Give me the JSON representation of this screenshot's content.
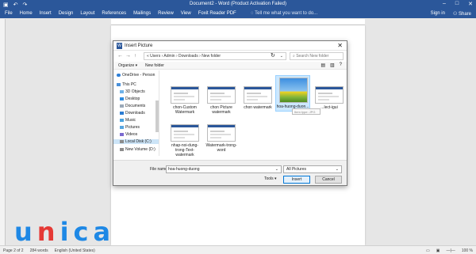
{
  "titlebar": {
    "title": "Document2 - Word (Product Activation Failed)",
    "save_icon": "save-icon",
    "undo_icon": "undo-icon",
    "redo_icon": "redo-icon"
  },
  "ribbon": {
    "tabs": [
      "File",
      "Home",
      "Insert",
      "Design",
      "Layout",
      "References",
      "Mailings",
      "Review",
      "View",
      "Foxit Reader PDF"
    ],
    "tell_me": "Tell me what you want to do...",
    "sign_in": "Sign in",
    "share": "Share",
    "accent": "#2b579a"
  },
  "dialog": {
    "title": "Insert Picture",
    "close": "✕",
    "address": [
      "This PC",
      "Users",
      "Admin",
      "Downloads",
      "New folder"
    ],
    "address_text": "« Users › Admin › Downloads › New folder",
    "search_placeholder": "Search New folder",
    "organize": "Organize ▾",
    "new_folder": "New folder",
    "nav": [
      {
        "label": "OneDrive - Person",
        "icon": "cloud-icon"
      },
      {
        "label": "This PC",
        "icon": "computer-icon"
      },
      {
        "label": "3D Objects",
        "icon": "cube-icon"
      },
      {
        "label": "Desktop",
        "icon": "desktop-icon"
      },
      {
        "label": "Documents",
        "icon": "document-icon"
      },
      {
        "label": "Downloads",
        "icon": "download-icon"
      },
      {
        "label": "Music",
        "icon": "music-icon"
      },
      {
        "label": "Pictures",
        "icon": "picture-icon"
      },
      {
        "label": "Videos",
        "icon": "video-icon"
      },
      {
        "label": "Local Disk (C:)",
        "icon": "drive-icon"
      },
      {
        "label": "New Volume (D:)",
        "icon": "drive-icon"
      }
    ],
    "files": [
      {
        "name": "chon-Custom Watermark"
      },
      {
        "name": "chon Picture watermark"
      },
      {
        "name": "chon watermark"
      },
      {
        "name": "hoa-huong-duon..."
      },
      {
        "name": "...lect-igui"
      },
      {
        "name": "nhap-noi-dung-trong-Text-watermark"
      },
      {
        "name": "Watermark-trong-word"
      }
    ],
    "tooltip": "Item type: JPG",
    "file_name_label": "File name:",
    "file_name_value": "hoa-huong-duong",
    "file_type": "All Pictures",
    "tools": "Tools ▾",
    "insert": "Insert",
    "cancel": "Cancel"
  },
  "statusbar": {
    "page": "Page 2 of 2",
    "words": "284 words",
    "language": "English (United States)",
    "zoom": "100 %"
  },
  "logo": {
    "brand": "unica",
    "color": "#1e88e5",
    "accent": "#e53935"
  }
}
